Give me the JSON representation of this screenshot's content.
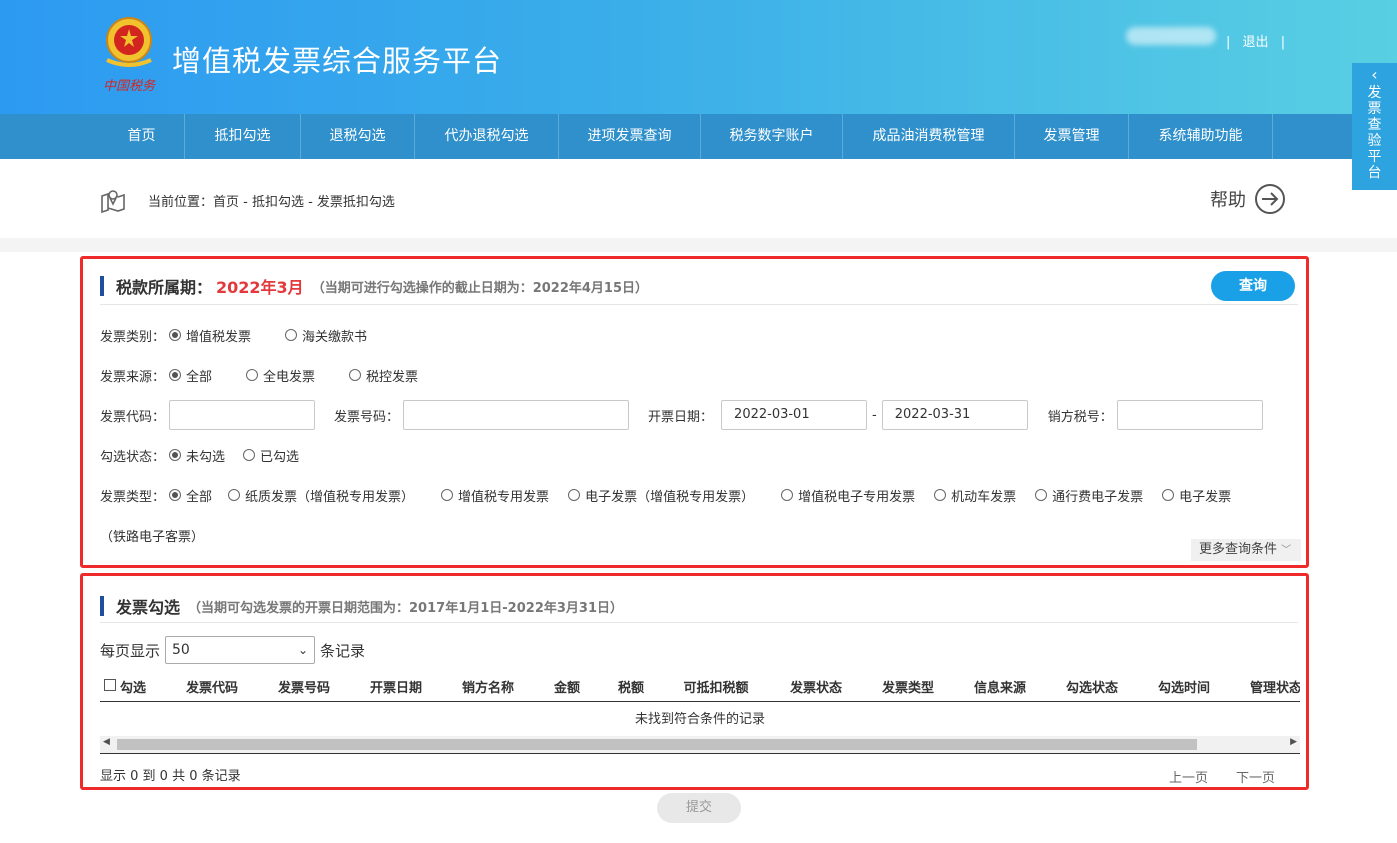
{
  "header": {
    "title": "增值税发票综合服务平台",
    "logo_text": "中国税务",
    "separator": "|",
    "logout_label": "退出"
  },
  "nav": {
    "items": [
      "首页",
      "抵扣勾选",
      "退税勾选",
      "代办退税勾选",
      "进项发票查询",
      "税务数字账户",
      "成品油消费税管理",
      "发票管理",
      "系统辅助功能"
    ]
  },
  "side_tab": {
    "label": "发票查验平台"
  },
  "breadcrumb": {
    "prefix": "当前位置：",
    "path": "首页 - 抵扣勾选 - 发票抵扣勾选"
  },
  "help": {
    "label": "帮助"
  },
  "query_panel": {
    "title": "税款所属期：",
    "period": "2022年3月",
    "note": "（当期可进行勾选操作的截止日期为：2022年4月15日）",
    "query_button": "查询",
    "invoice_category": {
      "label": "发票类别：",
      "options": [
        "增值税发票",
        "海关缴款书"
      ],
      "selected": "增值税发票"
    },
    "invoice_source": {
      "label": "发票来源：",
      "options": [
        "全部",
        "全电发票",
        "税控发票"
      ],
      "selected": "全部"
    },
    "invoice_code": {
      "label": "发票代码：",
      "value": ""
    },
    "invoice_number": {
      "label": "发票号码：",
      "value": ""
    },
    "issue_date": {
      "label": "开票日期：",
      "from": "2022-03-01",
      "sep": "-",
      "to": "2022-03-31"
    },
    "seller_tax_id": {
      "label": "销方税号：",
      "value": ""
    },
    "check_status": {
      "label": "勾选状态：",
      "options": [
        "未勾选",
        "已勾选"
      ],
      "selected": "未勾选"
    },
    "invoice_type": {
      "label": "发票类型：",
      "options": [
        "全部",
        "纸质发票（增值税专用发票）",
        "增值税专用发票",
        "电子发票（增值税专用发票）",
        "增值税电子专用发票",
        "机动车发票",
        "通行费电子发票",
        "电子发票"
      ],
      "wrap_text": "（铁路电子客票）",
      "selected": "全部"
    },
    "more_conditions": "更多查询条件"
  },
  "select_panel": {
    "title": "发票勾选",
    "note": "（当期可勾选发票的开票日期范围为：2017年1月1日-2022年3月31日）",
    "per_page_label": "每页显示",
    "per_page_value": "50",
    "per_page_suffix": "条记录",
    "columns": [
      "勾选",
      "发票代码",
      "发票号码",
      "开票日期",
      "销方名称",
      "金额",
      "税额",
      "可抵扣税额",
      "发票状态",
      "发票类型",
      "信息来源",
      "勾选状态",
      "勾选时间",
      "管理状态"
    ],
    "empty_text": "未找到符合条件的记录",
    "footer_text": "显示 0 到 0 共 0 条记录",
    "prev": "上一页",
    "next": "下一页"
  },
  "submit": {
    "label": "提交"
  }
}
